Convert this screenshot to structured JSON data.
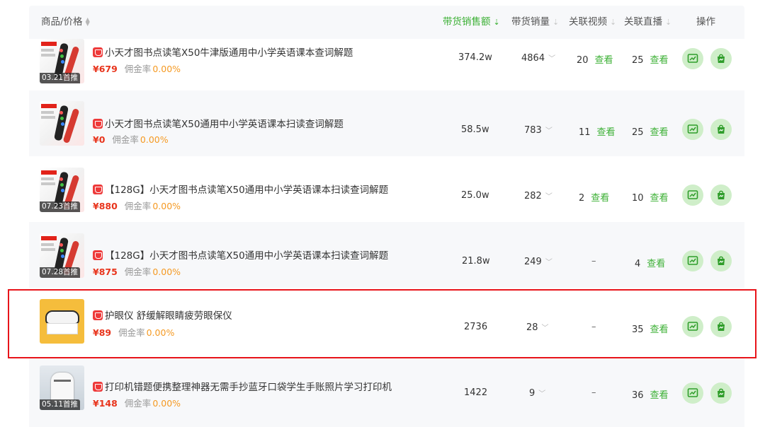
{
  "header": {
    "goods_price": "商品/价格",
    "sales_amount": "带货销售额",
    "sales_volume": "带货销量",
    "related_videos": "关联视频",
    "related_live": "关联直播",
    "actions": "操作"
  },
  "link_label": "查看",
  "commission_label": "佣金率",
  "rows": [
    {
      "title": "小天才图书点读笔X50牛津版通用中小学英语课本查词解题",
      "price": "¥679",
      "commission": "0.00%",
      "badge": "03.21首推",
      "sales_amount": "374.2w",
      "sales_volume": "4864",
      "videos": "20",
      "live": "25"
    },
    {
      "title": "小天才图书点读笔X50通用中小学英语课本扫读查词解题",
      "price": "¥0",
      "commission": "0.00%",
      "badge": "",
      "sales_amount": "58.5w",
      "sales_volume": "783",
      "videos": "11",
      "live": "25"
    },
    {
      "title": "【128G】小天才图书点读笔X50通用中小学英语课本扫读查词解题",
      "price": "¥880",
      "commission": "0.00%",
      "badge": "07.23首推",
      "sales_amount": "25.0w",
      "sales_volume": "282",
      "videos": "2",
      "live": "10"
    },
    {
      "title": "【128G】小天才图书点读笔X50通用中小学英语课本扫读查词解题",
      "price": "¥875",
      "commission": "0.00%",
      "badge": "07.28首推",
      "sales_amount": "21.8w",
      "sales_volume": "249",
      "videos": "–",
      "live": "4"
    },
    {
      "title": "护眼仪 舒缓解眼睛疲劳眼保仪",
      "price": "¥89",
      "commission": "0.00%",
      "badge": "",
      "sales_amount": "2736",
      "sales_volume": "28",
      "videos": "–",
      "live": "35"
    },
    {
      "title": "打印机错题便携整理神器无需手抄蓝牙口袋学生手账照片学习打印机",
      "price": "¥148",
      "commission": "0.00%",
      "badge": "05.11首推",
      "sales_amount": "1422",
      "sales_volume": "9",
      "videos": "–",
      "live": "36"
    }
  ],
  "colors": {
    "accent": "#3cb035",
    "price": "#e8341c",
    "commission": "#f59a23",
    "highlight": "#e8141a"
  },
  "icons": {
    "shop": "store-icon",
    "action1": "chart-icon",
    "action2": "shopping-bag-icon"
  }
}
